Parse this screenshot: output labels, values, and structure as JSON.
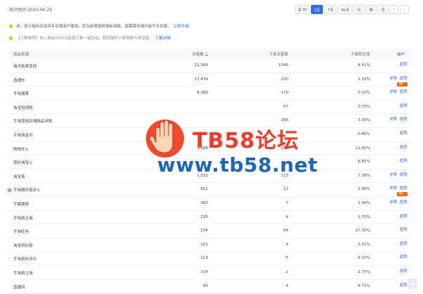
{
  "header": {
    "stat_time": "统计时间 2020-04-29",
    "ranges": [
      {
        "label": "实 时",
        "active": false
      },
      {
        "label": "1天",
        "active": true
      },
      {
        "label": "7天",
        "active": false
      },
      {
        "label": "30天",
        "active": false
      },
      {
        "label": "日",
        "active": false
      },
      {
        "label": "周",
        "active": false
      },
      {
        "label": "月",
        "active": false
      }
    ],
    "prev": "<",
    "next": ">"
  },
  "notices": [
    {
      "text": "亲，部分指标仅支持专业版用户使用，您当前使用的是标准版，如需使用请升级为专业版。",
      "link": "立即升级"
    },
    {
      "text": "【人群推荐】核心单品TOP10高潜人群一键生成，助您做好人群洞察与再营销。",
      "link": "了解详情"
    }
  ],
  "table": {
    "headers": {
      "source": "商品来源",
      "visitors": "访客数",
      "buyers": "下单买家数",
      "rate": "下单转化率",
      "ops": "操作"
    },
    "rows": [
      {
        "source": "淘内免费其他",
        "visitors": "21,364",
        "buyers": "1049",
        "rate": "4.91%",
        "ops": [
          "趋势"
        ],
        "promo": ""
      },
      {
        "source": "直通车",
        "visitors": "17,439",
        "buyers": "230",
        "rate": "1.32%",
        "ops": [
          "详情",
          "趋势"
        ],
        "promo": "推广"
      },
      {
        "source": "手淘搜索",
        "visitors": "8,380",
        "buyers": "170",
        "rate": "2.03%",
        "ops": [
          "详情",
          "趋势"
        ],
        "promo": ""
      },
      {
        "source": "淘宝短视频",
        "visitors": "",
        "buyers": "57",
        "rate": "0.73%",
        "ops": [
          "趋势"
        ],
        "promo": ""
      },
      {
        "source": "手淘其他店铺商品详情",
        "visitors": "",
        "buyers": "166",
        "rate": "3.30%",
        "ops": [
          "详情",
          "趋势"
        ],
        "promo": ""
      },
      {
        "source": "手淘淘金币",
        "visitors": "3,310",
        "buyers": "",
        "rate": "0.86%",
        "ops": [
          "趋势"
        ],
        "promo": ""
      },
      {
        "source": "购物车①",
        "visitors": "2,588",
        "buyers": "295",
        "rate": "11.40%",
        "ops": [
          "趋势"
        ],
        "promo": ""
      },
      {
        "source": "我的淘宝①",
        "visitors": "",
        "buyers": "",
        "rate": "6.85%",
        "ops": [
          "趋势"
        ],
        "promo": ""
      },
      {
        "source": "淘宝客",
        "visitors": "1,532",
        "buyers": "113",
        "rate": "7.38%",
        "ops": [
          "详情",
          "趋势"
        ],
        "promo": ""
      },
      {
        "source": "手淘猜你喜欢①",
        "visitors": "611",
        "buyers": "12",
        "rate": "1.96%",
        "ops": [
          "详情",
          "趋势"
        ],
        "promo": "推广",
        "selected": true
      },
      {
        "source": "手猫搜索",
        "visitors": "360",
        "buyers": "7",
        "rate": "1.94%",
        "ops": [
          "详情",
          "趋势"
        ],
        "promo": ""
      },
      {
        "source": "手淘拍立淘",
        "visitors": "235",
        "buyers": "4",
        "rate": "1.70%",
        "ops": [
          "趋势"
        ],
        "promo": ""
      },
      {
        "source": "手淘旺信",
        "visitors": "234",
        "buyers": "64",
        "rate": "27.35%",
        "ops": [
          "趋势"
        ],
        "promo": ""
      },
      {
        "source": "淘宝特价版",
        "visitors": "121",
        "buyers": "4",
        "rate": "3.31%",
        "ops": [
          "趋势"
        ],
        "promo": ""
      },
      {
        "source": "手淘我的评价",
        "visitors": "119",
        "buyers": "5",
        "rate": "4.20%",
        "ops": [
          "趋势"
        ],
        "promo": ""
      },
      {
        "source": "手淘拍立淘",
        "visitors": "114",
        "buyers": "2",
        "rate": "1.75%",
        "ops": [
          "趋势"
        ],
        "promo": ""
      },
      {
        "source": "直播间",
        "visitors": "85",
        "buyers": "4",
        "rate": "4.71%",
        "ops": [
          "趋势"
        ],
        "promo": ""
      }
    ]
  },
  "watermark": {
    "title": "TB58论坛",
    "url": "www.tb58.net"
  },
  "corner": {
    "line1": "激活",
    "line2": "转到"
  },
  "colors": {
    "accent": "#2f6bea",
    "promo": "#f26a0c",
    "warn": "#f5b900"
  }
}
